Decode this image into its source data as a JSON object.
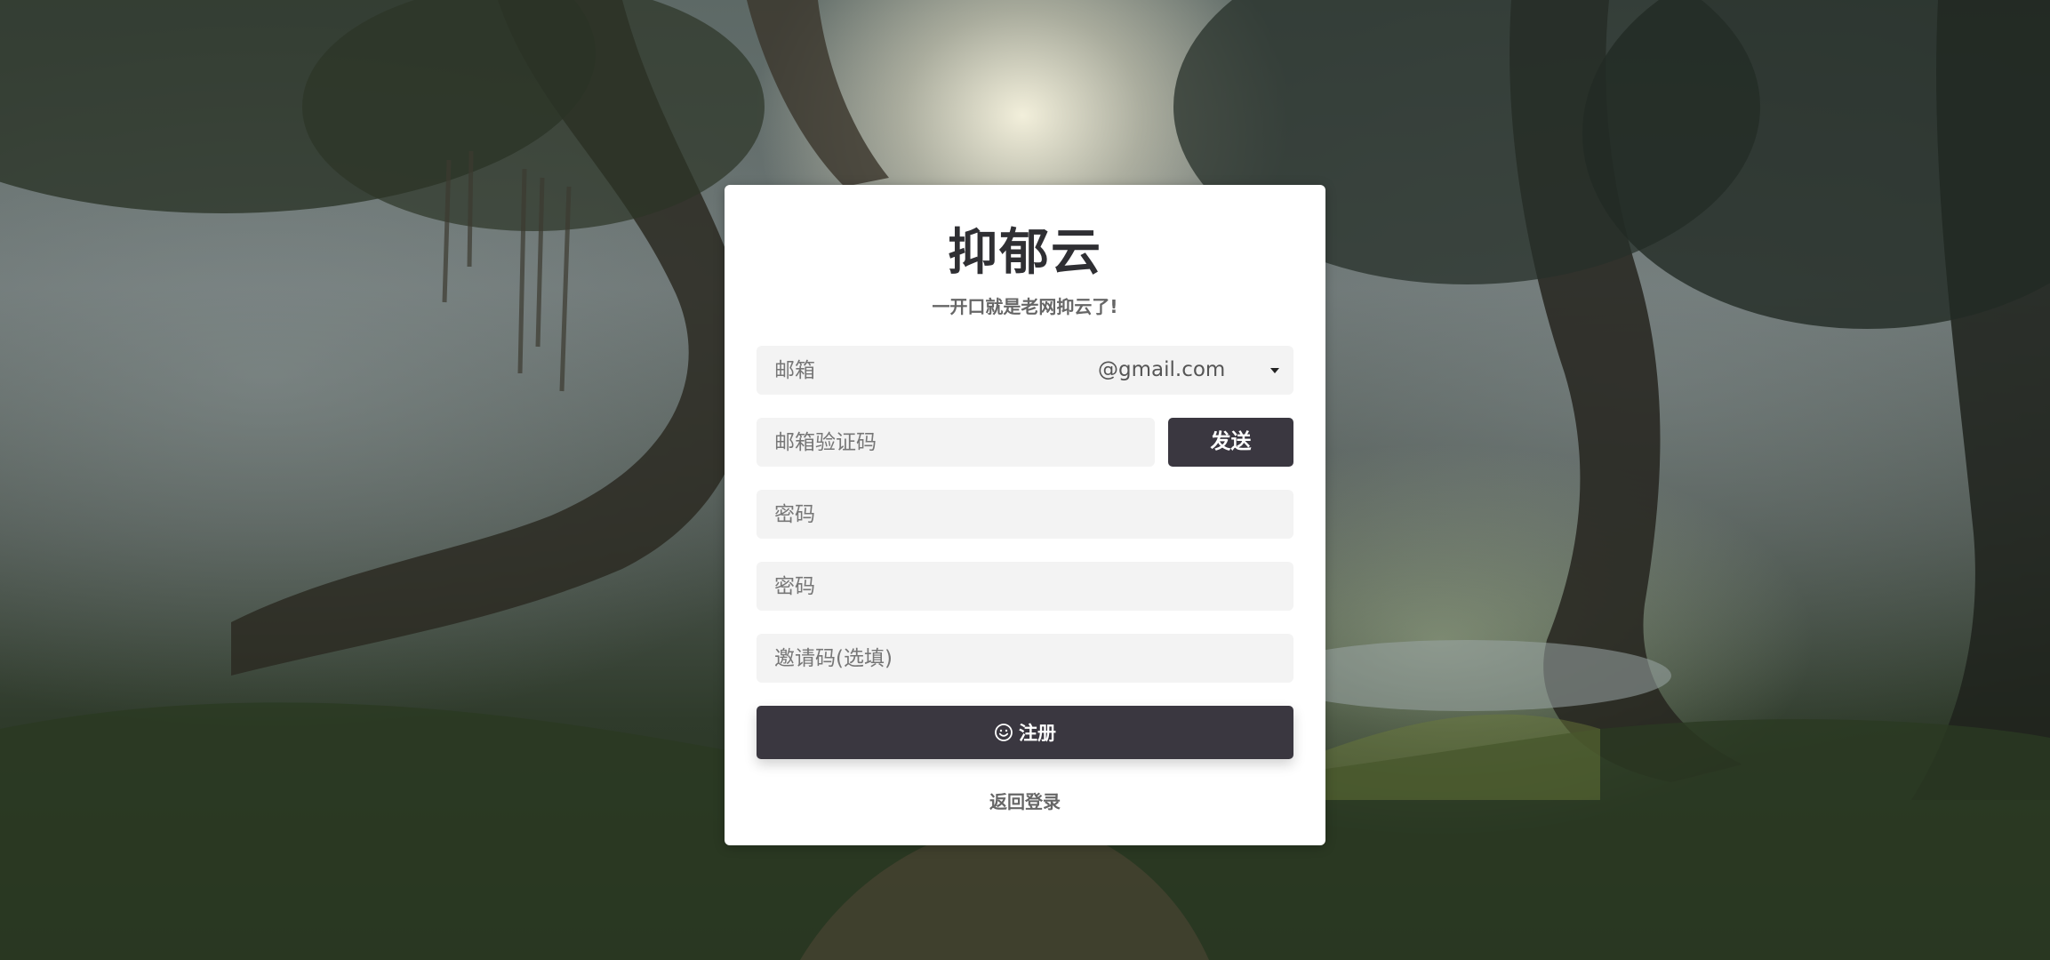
{
  "brand": {
    "title": "抑郁云",
    "subtitle": "一开口就是老网抑云了!"
  },
  "form": {
    "email": {
      "placeholder": "邮箱",
      "value": ""
    },
    "domain": {
      "selected": "@gmail.com"
    },
    "code": {
      "placeholder": "邮箱验证码",
      "value": ""
    },
    "send_label": "发送",
    "password": {
      "placeholder": "密码",
      "value": ""
    },
    "password_confirm": {
      "placeholder": "密码",
      "value": ""
    },
    "invite": {
      "placeholder": "邀请码(选填)",
      "value": ""
    },
    "register_label": "注册",
    "register_icon": "smile-icon",
    "back_label": "返回登录"
  },
  "colors": {
    "button_bg": "#3a3740",
    "card_bg": "#ffffff",
    "field_bg": "#f3f3f3"
  }
}
